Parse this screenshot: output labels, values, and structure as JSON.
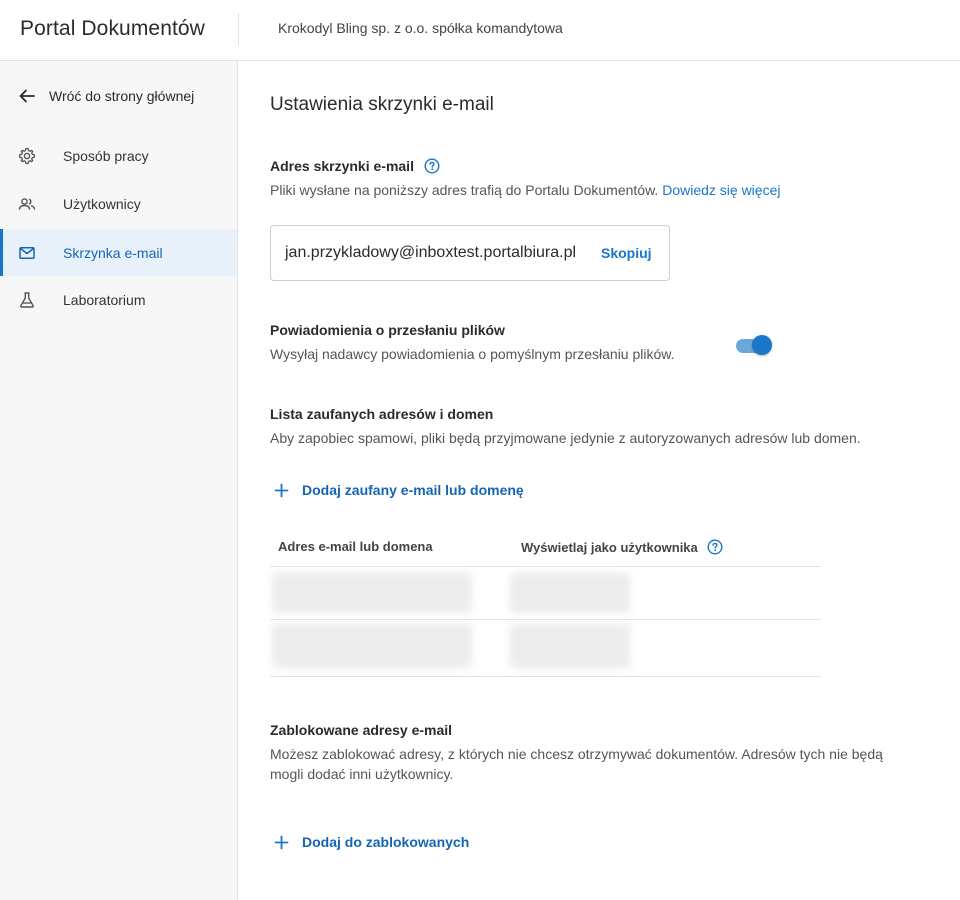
{
  "header": {
    "app_title": "Portal Dokumentów",
    "company": "Krokodyl Bling sp. z o.o. spółka komandytowa"
  },
  "sidebar": {
    "back_label": "Wróć do strony głównej",
    "items": [
      {
        "label": "Sposób pracy",
        "icon": "gear-icon"
      },
      {
        "label": "Użytkownicy",
        "icon": "users-icon"
      },
      {
        "label": "Skrzynka e-mail",
        "icon": "mail-icon",
        "active": true
      },
      {
        "label": "Laboratorium",
        "icon": "flask-icon"
      }
    ]
  },
  "main": {
    "title": "Ustawienia skrzynki e-mail",
    "mailbox": {
      "title": "Adres skrzynki e-mail",
      "desc": "Pliki wysłane na poniższy adres trafią do Portalu Dokumentów.",
      "link": "Dowiedz się więcej",
      "address": "jan.przykladowy@inboxtest.portalbiura.pl",
      "copy_label": "Skopiuj"
    },
    "notifications": {
      "title": "Powiadomienia o przesłaniu plików",
      "desc": "Wysyłaj nadawcy powiadomienia o pomyślnym przesłaniu plików.",
      "enabled": true
    },
    "trusted": {
      "title": "Lista zaufanych adresów i domen",
      "desc": "Aby zapobiec spamowi, pliki będą przyjmowane jedynie z autoryzowanych adresów lub domen.",
      "add_label": "Dodaj zaufany e-mail lub domenę",
      "columns": [
        "Adres e-mail lub domena",
        "Wyświetlaj jako użytkownika"
      ]
    },
    "blocked": {
      "title": "Zablokowane adresy e-mail",
      "desc": "Możesz zablokować adresy, z których nie chcesz otrzymywać dokumentów. Adresów tych nie będą mogli dodać inni użytkownicy.",
      "add_label": "Dodaj do zablokowanych"
    }
  },
  "colors": {
    "accent": "#1976c9",
    "active_bg": "#e8f1fa",
    "sidebar_bg": "#f7f7f7"
  }
}
